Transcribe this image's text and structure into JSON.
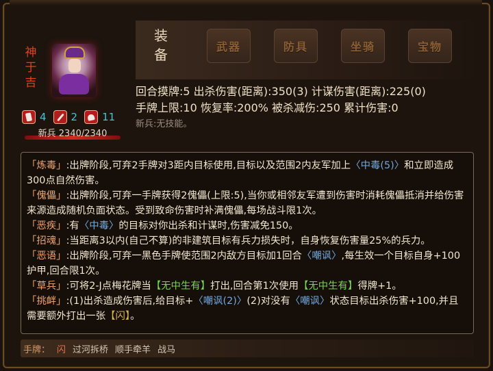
{
  "character": {
    "name": "神于吉",
    "name_chars": [
      "神",
      "于",
      "吉"
    ],
    "stats": [
      {
        "icon": "card-icon",
        "value": "4"
      },
      {
        "icon": "sword-icon",
        "value": "2"
      },
      {
        "icon": "heart-hand-icon",
        "value": "11"
      }
    ],
    "hp_text": "新兵 2340/2340",
    "hp_fraction": 1.0
  },
  "equipment": {
    "title_chars": [
      "装",
      "备"
    ],
    "slots": [
      "武器",
      "防具",
      "坐骑",
      "宝物"
    ]
  },
  "stats_panel": {
    "line1": "回合摸牌:5   出杀伤害(距离):350(3)   计谋伤害(距离):225(0)",
    "line2": "手牌上限:10   恢复率:200%   被杀减伤:250   累计伤害:0",
    "subline": "新兵:无技能。"
  },
  "skills": [
    {
      "name": "「炼毒」",
      "parts": [
        {
          "t": ":出牌阶段,可弃2手牌对3距内目标使用,目标以及范围2内友军加上"
        },
        {
          "t": "〈中毒(5)〉",
          "c": "blue"
        },
        {
          "t": "和立即造成300点自然伤害。"
        }
      ]
    },
    {
      "name": "「傀儡」",
      "parts": [
        {
          "t": ":出牌阶段,可弃一手牌获得2傀儡(上限:5),当你或相邻友军遭到伤害时消耗傀儡抵消并给伤害来源造成随机负面状态。受到致命伤害时补满傀儡,每场战斗限1次。"
        }
      ]
    },
    {
      "name": "「恶疾」",
      "parts": [
        {
          "t": ":有"
        },
        {
          "t": "〈中毒〉",
          "c": "blue"
        },
        {
          "t": "的目标对你出杀和计谋时,伤害减免150。"
        }
      ]
    },
    {
      "name": "「招魂」",
      "parts": [
        {
          "t": ":当距离3以内(自己不算)的非建筑目标有兵力损失时，自身恢复伤害量25%的兵力。"
        }
      ]
    },
    {
      "name": "「恶语」",
      "parts": [
        {
          "t": ":出牌阶段,可弃一黑色手牌使范围2内敌方目标加1回合"
        },
        {
          "t": "〈嘲讽〉",
          "c": "blue"
        },
        {
          "t": ",每生效一个目标自身+100护甲,回合限1次。"
        }
      ]
    },
    {
      "name": "「草兵」",
      "parts": [
        {
          "t": ":可将2-J点梅花牌当"
        },
        {
          "t": "【无中生有】",
          "c": "green"
        },
        {
          "t": "打出,回合第1次使用"
        },
        {
          "t": "【无中生有】",
          "c": "green"
        },
        {
          "t": "得牌+1。"
        }
      ]
    },
    {
      "name": "「挑衅」",
      "parts": [
        {
          "t": ":(1)出杀造成伤害后,给目标+"
        },
        {
          "t": "〈嘲讽(2)〉",
          "c": "blue"
        },
        {
          "t": "(2)对没有"
        },
        {
          "t": "〈嘲讽〉",
          "c": "blue"
        },
        {
          "t": "状态目标出杀伤害+100,并且需要额外打出一张"
        },
        {
          "t": "【闪】",
          "c": "yellow"
        },
        {
          "t": "。"
        }
      ]
    }
  ],
  "hand": {
    "label": "手牌：",
    "cards": [
      "闪",
      "过河拆桥",
      "顺手牵羊",
      "战马"
    ]
  },
  "colors": {
    "accent_orange": "#e9a16d",
    "keyword_blue": "#6fa9e0",
    "keyword_green": "#79d451",
    "keyword_yellow": "#d8b54a",
    "stat_cyan": "#41c6d6",
    "name_red": "#e0411e"
  }
}
